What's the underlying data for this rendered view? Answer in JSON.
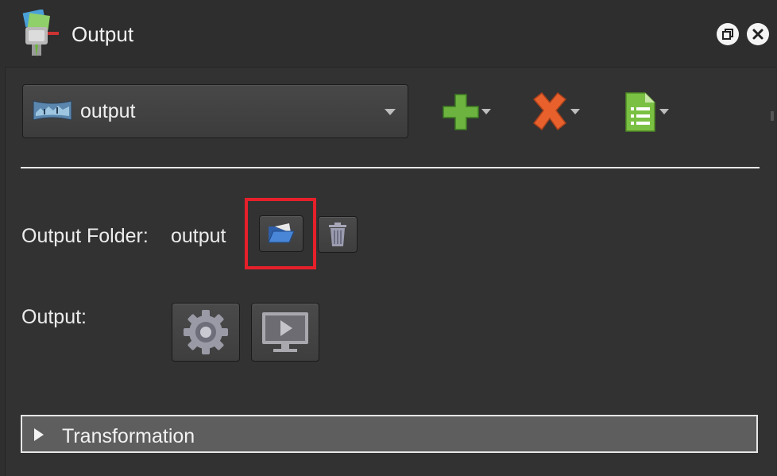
{
  "window": {
    "title": "Output"
  },
  "title_buttons": {
    "restore_icon": "restore-icon",
    "close_icon": "close-icon"
  },
  "profile": {
    "selected": "output",
    "icon": "panorama-icon"
  },
  "toolbar": {
    "add_icon": "plus-icon",
    "remove_icon": "x-icon",
    "document_icon": "document-list-icon"
  },
  "output_folder": {
    "label": "Output Folder:",
    "value": "output"
  },
  "output": {
    "label": "Output:",
    "settings_icon": "gear-icon",
    "preview_icon": "monitor-play-icon"
  },
  "transformation": {
    "label": "Transformation"
  },
  "colors": {
    "add": "#6db33f",
    "remove": "#e8612c",
    "document": "#7ac143",
    "highlight": "#e6202a"
  }
}
